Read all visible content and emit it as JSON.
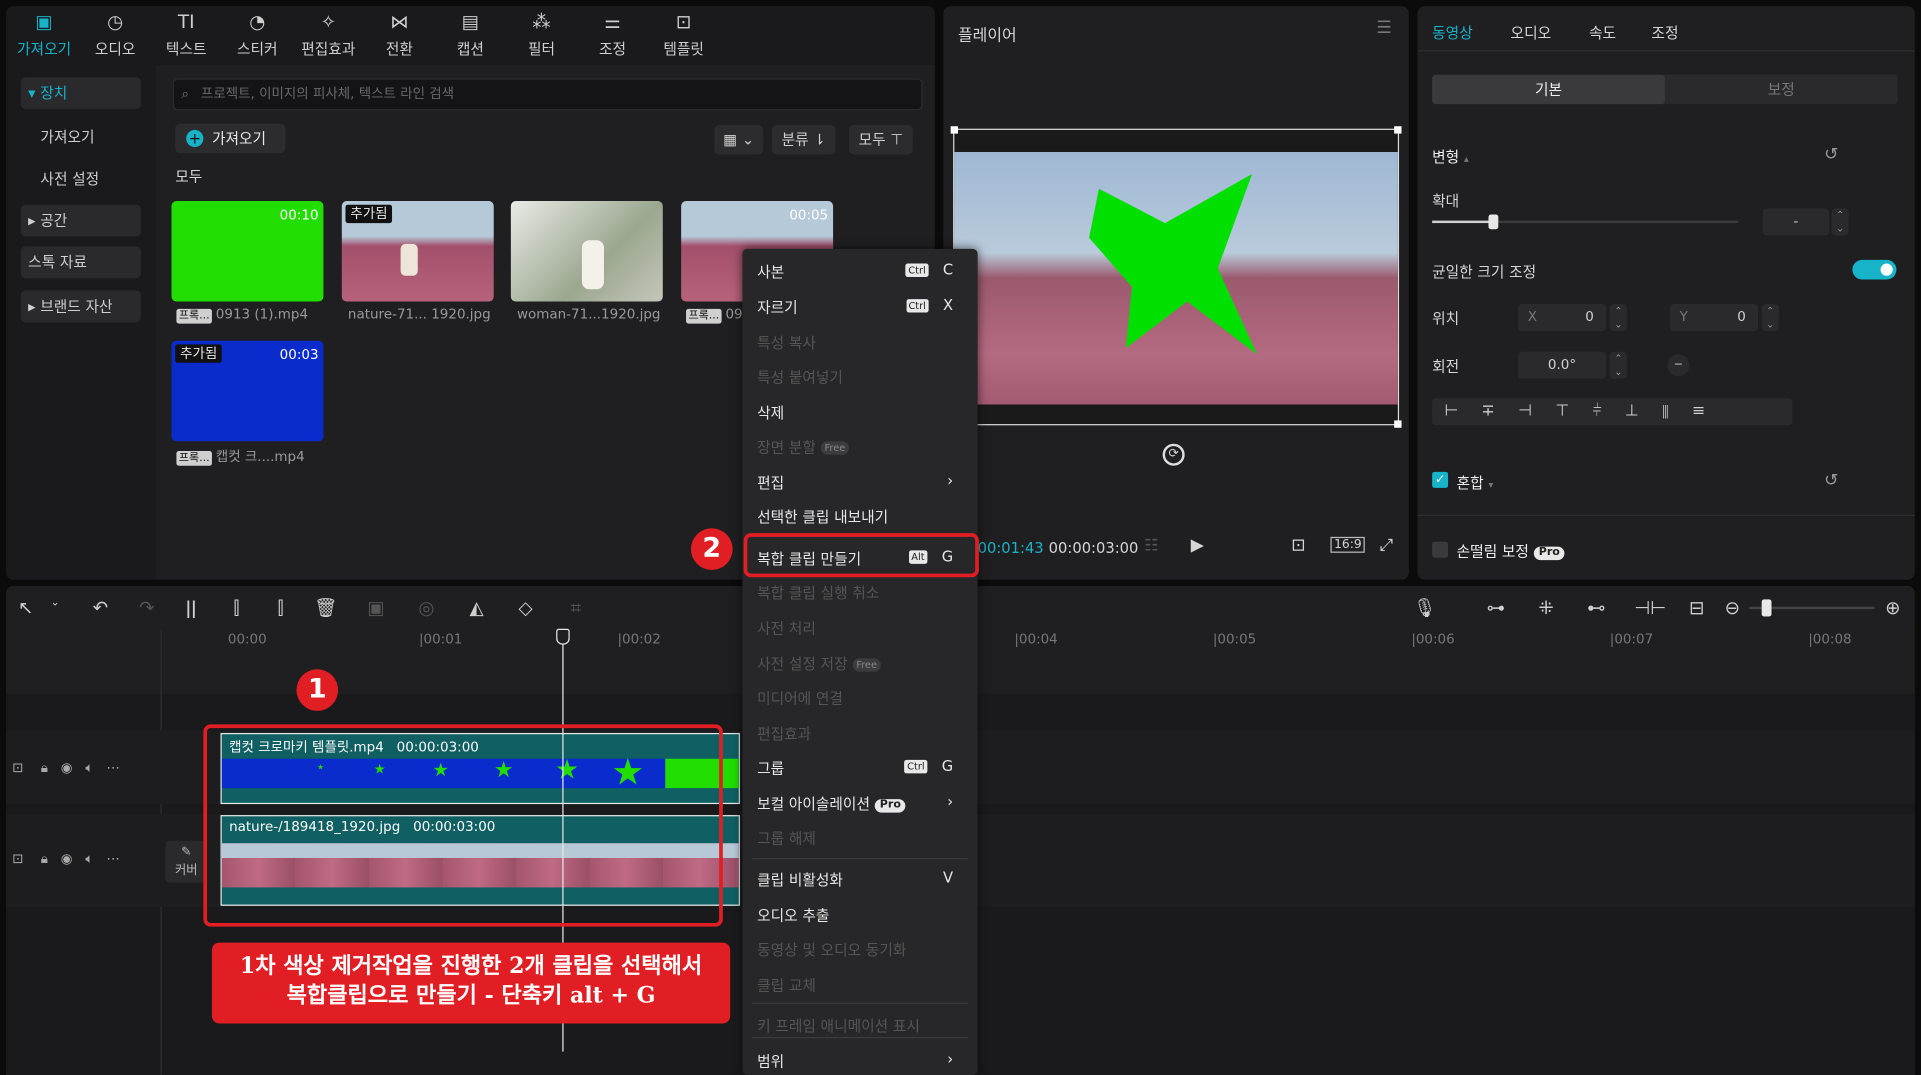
{
  "top_tabs": [
    {
      "label": "가져오기",
      "icon": "import-icon",
      "glyph": "▣"
    },
    {
      "label": "오디오",
      "icon": "audio-icon",
      "glyph": "◷"
    },
    {
      "label": "텍스트",
      "icon": "text-icon",
      "glyph": "TI"
    },
    {
      "label": "스티커",
      "icon": "sticker-icon",
      "glyph": "◔"
    },
    {
      "label": "편집효과",
      "icon": "effects-icon",
      "glyph": "✧"
    },
    {
      "label": "전환",
      "icon": "transition-icon",
      "glyph": "⋈"
    },
    {
      "label": "캡션",
      "icon": "caption-icon",
      "glyph": "▤"
    },
    {
      "label": "필터",
      "icon": "filter-icon",
      "glyph": "⁂"
    },
    {
      "label": "조정",
      "icon": "adjust-icon",
      "glyph": "⚌"
    },
    {
      "label": "템플릿",
      "icon": "template-icon",
      "glyph": "⊡"
    }
  ],
  "sidebar": [
    "▾ 장치",
    "가져오기",
    "사전 설정",
    "▸ 공간",
    "스톡 자료",
    "▸ 브랜드 자산"
  ],
  "media": {
    "search_placeholder": "프로젝트, 이미지의 피사체, 텍스트 라인 검색",
    "import_label": "가져오기",
    "sort_label": "분류",
    "filter_label": "모두",
    "section_label": "모두",
    "items": [
      {
        "badge": "",
        "duration": "00:10",
        "tag": "프록...",
        "name": "0913 (1).mp4"
      },
      {
        "badge": "추가됨",
        "duration": "",
        "tag": "",
        "name": "nature-71... 1920.jpg"
      },
      {
        "badge": "",
        "duration": "",
        "tag": "",
        "name": "woman-71...1920.jpg"
      },
      {
        "badge": "",
        "duration": "00:05",
        "tag": "프록...",
        "name": "09"
      },
      {
        "badge": "추가됨",
        "duration": "00:03",
        "tag": "프록...",
        "name": "캡컷 크....mp4"
      }
    ]
  },
  "player": {
    "title": "플레이어",
    "current_time": "00:01:43",
    "total_time": "00:00:03:00",
    "ratio": "16:9"
  },
  "inspector": {
    "tabs": [
      "동영상",
      "오디오",
      "속도",
      "조정"
    ],
    "subtabs": [
      "기본",
      "보정"
    ],
    "transform_label": "변형",
    "scale_label": "확대",
    "scale_value": "-",
    "scale_level": 0.2,
    "uniform_label": "균일한 크기 조정",
    "position_label": "위치",
    "pos_x_label": "X",
    "pos_x": "0",
    "pos_y_label": "Y",
    "pos_y": "0",
    "rotation_label": "회전",
    "rotation": "0.0°",
    "blend_label": "혼합",
    "stabilize_label": "손떨림 보정",
    "pro": "Pro"
  },
  "context_menu": {
    "items": [
      {
        "label": "사본",
        "key": "C",
        "mod": "Ctrl",
        "disabled": false
      },
      {
        "label": "자르기",
        "key": "X",
        "mod": "Ctrl",
        "disabled": false
      },
      {
        "label": "특성 복사",
        "disabled": true
      },
      {
        "label": "특성 붙여넣기",
        "disabled": true
      },
      {
        "label": "삭제",
        "disabled": false
      },
      {
        "label": "장면 분할",
        "badge": "Free",
        "disabled": true
      },
      {
        "label": "편집",
        "submenu": true,
        "disabled": false
      },
      {
        "label": "선택한 클립 내보내기",
        "disabled": false
      },
      {
        "label": "복합 클립 만들기",
        "key": "G",
        "mod": "Alt",
        "disabled": false
      },
      {
        "label": "복합 클립 실행 취소",
        "disabled": true
      },
      {
        "label": "사전 처리",
        "disabled": true
      },
      {
        "label": "사전 설정 저장",
        "badge": "Free",
        "disabled": true
      },
      {
        "label": "미디어에 연결",
        "disabled": true
      },
      {
        "label": "편집효과",
        "disabled": true
      },
      {
        "label": "그룹",
        "key": "G",
        "mod": "Ctrl",
        "disabled": false
      },
      {
        "label": "보컬 아이솔레이션",
        "badge": "Pro",
        "submenu": true,
        "disabled": false
      },
      {
        "label": "그룹 해제",
        "disabled": true
      },
      {
        "label": "클립 비활성화",
        "key": "V",
        "disabled": false
      },
      {
        "label": "오디오 추출",
        "disabled": false
      },
      {
        "label": "동영상 및 오디오 동기화",
        "disabled": true
      },
      {
        "label": "클립 교체",
        "disabled": true
      },
      {
        "label": "키 프레임 애니메이션 표시",
        "disabled": true
      },
      {
        "label": "범위",
        "submenu": true,
        "disabled": false
      }
    ]
  },
  "timeline": {
    "ruler": [
      "00:00",
      "|00:01",
      "|00:02",
      "|00:04",
      "|00:05",
      "|00:06",
      "|00:07",
      "|00:08"
    ],
    "clip1": {
      "name": "캡컷 크로마키 템플릿.mp4",
      "duration": "00:00:03:00"
    },
    "clip2": {
      "name": "nature-/189418_1920.jpg",
      "duration": "00:00:03:00"
    },
    "cover_label": "커버"
  },
  "annotations": {
    "num1": "1",
    "num2": "2",
    "note_line1": "1차 색상 제거작업을 진행한 2개 클립을 선택해서",
    "note_line2": "복합클립으로 만들기 - 단축키 alt + G"
  },
  "colors": {
    "accent": "#16b3c9",
    "highlight": "#e21e25",
    "chroma_green": "#00e000",
    "chroma_blue": "#0033cc"
  }
}
